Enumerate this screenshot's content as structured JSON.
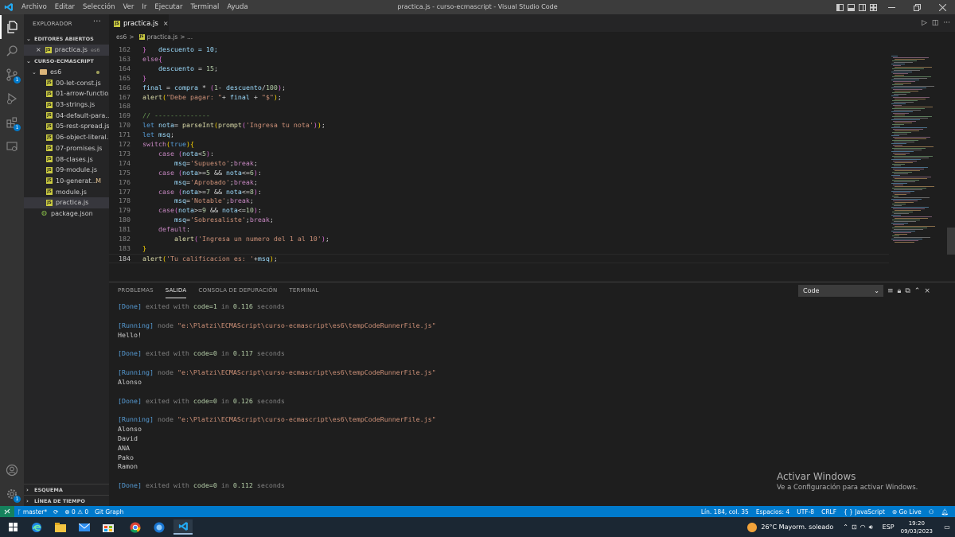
{
  "titlebar": {
    "menu": [
      "Archivo",
      "Editar",
      "Selección",
      "Ver",
      "Ir",
      "Ejecutar",
      "Terminal",
      "Ayuda"
    ],
    "title": "practica.js - curso-ecmascript - Visual Studio Code"
  },
  "activity_bar": {
    "items": [
      "explorer-icon",
      "search-icon",
      "source-control-icon",
      "run-debug-icon",
      "extensions-icon",
      "remote-explorer-icon"
    ],
    "badges": {
      "source_control": "1",
      "extensions": "1"
    },
    "bottom": [
      "account-icon",
      "settings-gear-icon"
    ]
  },
  "sidebar": {
    "title": "EXPLORADOR",
    "more": "···",
    "open_editors_title": "EDITORES ABIERTOS",
    "open_editor": {
      "name": "practica.js",
      "folder": "es6"
    },
    "project_title": "CURSO-ECMASCRIPT",
    "folder": "es6",
    "files": [
      {
        "name": "00-let-const.js",
        "type": "js"
      },
      {
        "name": "01-arrow-functio...",
        "type": "js"
      },
      {
        "name": "03-strings.js",
        "type": "js"
      },
      {
        "name": "04-default-para...",
        "type": "js"
      },
      {
        "name": "05-rest-spread.js",
        "type": "js"
      },
      {
        "name": "06-object-literal...",
        "type": "js"
      },
      {
        "name": "07-promises.js",
        "type": "js"
      },
      {
        "name": "08-clases.js",
        "type": "js"
      },
      {
        "name": "09-module.js",
        "type": "js"
      },
      {
        "name": "10-generat...",
        "type": "js",
        "flag": "M"
      },
      {
        "name": "module.js",
        "type": "js"
      },
      {
        "name": "practica.js",
        "type": "js",
        "selected": true
      }
    ],
    "root_file": "package.json",
    "outline": "ESQUEMA",
    "timeline": "LÍNEA DE TIEMPO"
  },
  "editor": {
    "tab": {
      "name": "practica.js",
      "close": "×"
    },
    "breadcrumbs": {
      "folder": "es6",
      "sep": ">",
      "file": "practica.js",
      "tail": "> ..."
    },
    "lines": [
      {
        "n": "162",
        "tokens": [
          {
            "t": "}",
            "c": "br2"
          }
        ]
      },
      {
        "n": "163",
        "tokens": [
          {
            "t": "else",
            "c": "k1"
          },
          {
            "t": "{",
            "c": "br2"
          }
        ]
      },
      {
        "n": "164",
        "tokens": [
          {
            "t": "    ",
            "c": "p"
          },
          {
            "t": "descuento",
            "c": "v"
          },
          {
            "t": " = ",
            "c": "p"
          },
          {
            "t": "15",
            "c": "n"
          },
          {
            "t": ";",
            "c": "p"
          }
        ]
      },
      {
        "n": "165",
        "tokens": [
          {
            "t": "}",
            "c": "br2"
          }
        ]
      },
      {
        "n": "166",
        "tokens": [
          {
            "t": "final",
            "c": "v"
          },
          {
            "t": " = ",
            "c": "p"
          },
          {
            "t": "compra",
            "c": "v"
          },
          {
            "t": " * ",
            "c": "p"
          },
          {
            "t": "(",
            "c": "br2"
          },
          {
            "t": "1",
            "c": "n"
          },
          {
            "t": "- ",
            "c": "p"
          },
          {
            "t": "descuento",
            "c": "v"
          },
          {
            "t": "/",
            "c": "p"
          },
          {
            "t": "100",
            "c": "n"
          },
          {
            "t": ")",
            "c": "br2"
          },
          {
            "t": ";",
            "c": "p"
          }
        ]
      },
      {
        "n": "167",
        "tokens": [
          {
            "t": "alert",
            "c": "f"
          },
          {
            "t": "(",
            "c": "br"
          },
          {
            "t": "\"Debe pagar: \"",
            "c": "s"
          },
          {
            "t": "+ ",
            "c": "p"
          },
          {
            "t": "final",
            "c": "v"
          },
          {
            "t": " + ",
            "c": "p"
          },
          {
            "t": "\"$\"",
            "c": "s"
          },
          {
            "t": ")",
            "c": "br"
          },
          {
            "t": ";",
            "c": "p"
          }
        ]
      },
      {
        "n": "168",
        "tokens": []
      },
      {
        "n": "169",
        "tokens": [
          {
            "t": "// --------------",
            "c": "c"
          }
        ]
      },
      {
        "n": "170",
        "tokens": [
          {
            "t": "let",
            "c": "k2"
          },
          {
            "t": " ",
            "c": "p"
          },
          {
            "t": "nota",
            "c": "v"
          },
          {
            "t": "= ",
            "c": "p"
          },
          {
            "t": "parseInt",
            "c": "f"
          },
          {
            "t": "(",
            "c": "br"
          },
          {
            "t": "prompt",
            "c": "f"
          },
          {
            "t": "(",
            "c": "br2"
          },
          {
            "t": "'Ingresa tu nota'",
            "c": "s"
          },
          {
            "t": ")",
            "c": "br2"
          },
          {
            "t": ")",
            "c": "br"
          },
          {
            "t": ";",
            "c": "p"
          }
        ]
      },
      {
        "n": "171",
        "tokens": [
          {
            "t": "let",
            "c": "k2"
          },
          {
            "t": " ",
            "c": "p"
          },
          {
            "t": "msq",
            "c": "v"
          },
          {
            "t": ";",
            "c": "p"
          }
        ]
      },
      {
        "n": "172",
        "tokens": [
          {
            "t": "switch",
            "c": "k1"
          },
          {
            "t": "(",
            "c": "br"
          },
          {
            "t": "true",
            "c": "k2"
          },
          {
            "t": ")",
            "c": "br"
          },
          {
            "t": "{",
            "c": "br"
          }
        ]
      },
      {
        "n": "173",
        "tokens": [
          {
            "t": "    ",
            "c": "p"
          },
          {
            "t": "case",
            "c": "k1"
          },
          {
            "t": " ",
            "c": "p"
          },
          {
            "t": "(",
            "c": "br2"
          },
          {
            "t": "nota",
            "c": "v"
          },
          {
            "t": "<",
            "c": "p"
          },
          {
            "t": "5",
            "c": "n"
          },
          {
            "t": ")",
            "c": "br2"
          },
          {
            "t": ":",
            "c": "p"
          }
        ]
      },
      {
        "n": "174",
        "tokens": [
          {
            "t": "        ",
            "c": "p"
          },
          {
            "t": "msq",
            "c": "v"
          },
          {
            "t": "=",
            "c": "p"
          },
          {
            "t": "'Supuesto'",
            "c": "s"
          },
          {
            "t": ";",
            "c": "p"
          },
          {
            "t": "break",
            "c": "k1"
          },
          {
            "t": ";",
            "c": "p"
          }
        ]
      },
      {
        "n": "175",
        "tokens": [
          {
            "t": "    ",
            "c": "p"
          },
          {
            "t": "case",
            "c": "k1"
          },
          {
            "t": " ",
            "c": "p"
          },
          {
            "t": "(",
            "c": "br2"
          },
          {
            "t": "nota",
            "c": "v"
          },
          {
            "t": ">=",
            "c": "p"
          },
          {
            "t": "5",
            "c": "n"
          },
          {
            "t": " && ",
            "c": "p"
          },
          {
            "t": "nota",
            "c": "v"
          },
          {
            "t": "<=",
            "c": "p"
          },
          {
            "t": "6",
            "c": "n"
          },
          {
            "t": ")",
            "c": "br2"
          },
          {
            "t": ":",
            "c": "p"
          }
        ]
      },
      {
        "n": "176",
        "tokens": [
          {
            "t": "        ",
            "c": "p"
          },
          {
            "t": "msq",
            "c": "v"
          },
          {
            "t": "=",
            "c": "p"
          },
          {
            "t": "'Aprobado'",
            "c": "s"
          },
          {
            "t": ";",
            "c": "p"
          },
          {
            "t": "break",
            "c": "k1"
          },
          {
            "t": ";",
            "c": "p"
          }
        ]
      },
      {
        "n": "177",
        "tokens": [
          {
            "t": "    ",
            "c": "p"
          },
          {
            "t": "case",
            "c": "k1"
          },
          {
            "t": " ",
            "c": "p"
          },
          {
            "t": "(",
            "c": "br2"
          },
          {
            "t": "nota",
            "c": "v"
          },
          {
            "t": ">=",
            "c": "p"
          },
          {
            "t": "7",
            "c": "n"
          },
          {
            "t": " && ",
            "c": "p"
          },
          {
            "t": "nota",
            "c": "v"
          },
          {
            "t": "<=",
            "c": "p"
          },
          {
            "t": "8",
            "c": "n"
          },
          {
            "t": ")",
            "c": "br2"
          },
          {
            "t": ":",
            "c": "p"
          }
        ]
      },
      {
        "n": "178",
        "tokens": [
          {
            "t": "        ",
            "c": "p"
          },
          {
            "t": "msq",
            "c": "v"
          },
          {
            "t": "=",
            "c": "p"
          },
          {
            "t": "'Notable'",
            "c": "s"
          },
          {
            "t": ";",
            "c": "p"
          },
          {
            "t": "break",
            "c": "k1"
          },
          {
            "t": ";",
            "c": "p"
          }
        ]
      },
      {
        "n": "179",
        "tokens": [
          {
            "t": "    ",
            "c": "p"
          },
          {
            "t": "case",
            "c": "k1"
          },
          {
            "t": "(",
            "c": "br2"
          },
          {
            "t": "nota",
            "c": "v"
          },
          {
            "t": ">=",
            "c": "p"
          },
          {
            "t": "9",
            "c": "n"
          },
          {
            "t": " && ",
            "c": "p"
          },
          {
            "t": "nota",
            "c": "v"
          },
          {
            "t": "<=",
            "c": "p"
          },
          {
            "t": "10",
            "c": "n"
          },
          {
            "t": ")",
            "c": "br2"
          },
          {
            "t": ":",
            "c": "p"
          }
        ]
      },
      {
        "n": "180",
        "tokens": [
          {
            "t": "        ",
            "c": "p"
          },
          {
            "t": "msq",
            "c": "v"
          },
          {
            "t": "=",
            "c": "p"
          },
          {
            "t": "'Sobresaliste'",
            "c": "s"
          },
          {
            "t": ";",
            "c": "p"
          },
          {
            "t": "break",
            "c": "k1"
          },
          {
            "t": ";",
            "c": "p"
          }
        ]
      },
      {
        "n": "181",
        "tokens": [
          {
            "t": "    ",
            "c": "p"
          },
          {
            "t": "default",
            "c": "k1"
          },
          {
            "t": ":",
            "c": "p"
          }
        ]
      },
      {
        "n": "182",
        "tokens": [
          {
            "t": "        ",
            "c": "p"
          },
          {
            "t": "alert",
            "c": "f"
          },
          {
            "t": "(",
            "c": "br2"
          },
          {
            "t": "'Ingresa un numero del 1 al 10'",
            "c": "s"
          },
          {
            "t": ")",
            "c": "br2"
          },
          {
            "t": ";",
            "c": "p"
          }
        ]
      },
      {
        "n": "183",
        "tokens": [
          {
            "t": "}",
            "c": "br"
          }
        ]
      },
      {
        "n": "184",
        "tokens": [
          {
            "t": "alert",
            "c": "f"
          },
          {
            "t": "(",
            "c": "br"
          },
          {
            "t": "'Tu calificacion es: '",
            "c": "s"
          },
          {
            "t": "+",
            "c": "p"
          },
          {
            "t": "msq",
            "c": "v"
          },
          {
            "t": ")",
            "c": "br"
          },
          {
            "t": ";",
            "c": "p"
          }
        ],
        "current": true
      }
    ],
    "partial_top_line": "    descuento = 10;"
  },
  "panel": {
    "tabs": [
      "PROBLEMAS",
      "SALIDA",
      "CONSOLA DE DEPURACIÓN",
      "TERMINAL"
    ],
    "active_tab": "SALIDA",
    "dropdown_value": "Code",
    "output": [
      {
        "kind": "done",
        "text": "[Done] exited with code=1 in 0.116 seconds"
      },
      {
        "kind": "blank",
        "text": ""
      },
      {
        "kind": "run",
        "text": "[Running] node \"e:\\Platzi\\ECMAScript\\curso-ecmascript\\es6\\tempCodeRunnerFile.js\""
      },
      {
        "kind": "plain",
        "text": "Hello!"
      },
      {
        "kind": "blank",
        "text": ""
      },
      {
        "kind": "done",
        "text": "[Done] exited with code=0 in 0.117 seconds"
      },
      {
        "kind": "blank",
        "text": ""
      },
      {
        "kind": "run",
        "text": "[Running] node \"e:\\Platzi\\ECMAScript\\curso-ecmascript\\es6\\tempCodeRunnerFile.js\""
      },
      {
        "kind": "plain",
        "text": "Alonso"
      },
      {
        "kind": "blank",
        "text": ""
      },
      {
        "kind": "done",
        "text": "[Done] exited with code=0 in 0.126 seconds"
      },
      {
        "kind": "blank",
        "text": ""
      },
      {
        "kind": "run",
        "text": "[Running] node \"e:\\Platzi\\ECMAScript\\curso-ecmascript\\es6\\tempCodeRunnerFile.js\""
      },
      {
        "kind": "plain",
        "text": "Alonso"
      },
      {
        "kind": "plain",
        "text": "David"
      },
      {
        "kind": "plain",
        "text": "ANA"
      },
      {
        "kind": "plain",
        "text": "Pako"
      },
      {
        "kind": "plain",
        "text": "Ramon"
      },
      {
        "kind": "blank",
        "text": ""
      },
      {
        "kind": "done",
        "text": "[Done] exited with code=0 in 0.112 seconds"
      }
    ],
    "watermark_title": "Activar Windows",
    "watermark_sub": "Ve a Configuración para activar Windows."
  },
  "statusbar": {
    "branch": "master*",
    "sync": "⟳",
    "problems": "⊗ 0 ⚠ 0",
    "git_graph": "Git Graph",
    "position": "Lín. 184, col. 35",
    "spaces": "Espacios: 4",
    "encoding": "UTF-8",
    "eol": "CRLF",
    "language": "{ } JavaScript",
    "golive": "Go Live"
  },
  "taskbar": {
    "apps": [
      "windows-start-icon",
      "edge-icon",
      "mail-icon",
      "store-icon",
      "chrome-icon",
      "app-blue-icon",
      "vscode-icon"
    ],
    "weather": "26°C  Mayorm. soleado",
    "lang": "ESP",
    "time": "19:20",
    "date": "09/03/2023"
  },
  "colors": {
    "accent": "#007acc",
    "activity_bar": "#333333",
    "sidebar": "#252526",
    "editor_bg": "#1e1e1e",
    "titlebar": "#3c3c3c",
    "taskbar": "#1b2733"
  }
}
